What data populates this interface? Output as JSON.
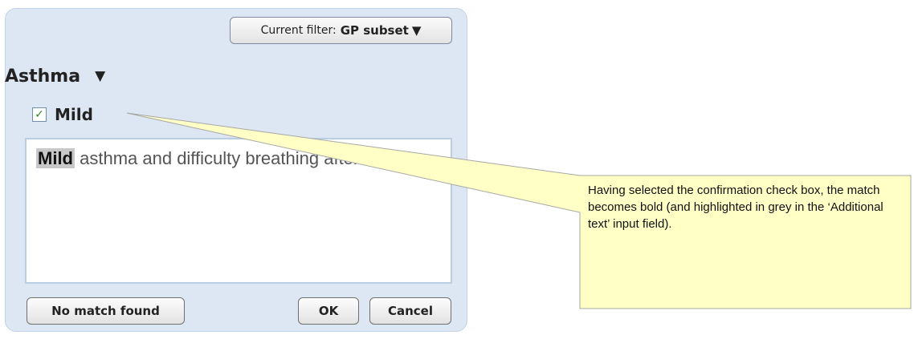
{
  "dialog": {
    "filter": {
      "prefix": "Current filter:",
      "value": "GP subset",
      "arrow": "▼"
    },
    "heading": {
      "text": "Asthma",
      "arrow": "▼"
    },
    "confirm_checkbox": {
      "label": "Mild",
      "checked": true,
      "check_glyph": "✓"
    },
    "additional_text": {
      "match": "Mild",
      "rest": " asthma and difficulty breathing after exercise"
    },
    "buttons": {
      "no_match": "No match found",
      "ok": "OK",
      "cancel": "Cancel"
    }
  },
  "callout": {
    "text": "Having selected the confirmation check box, the match becomes bold (and highlighted in grey in the ‘Additional text’ input field).",
    "fill_color": "#ffffc6",
    "border_color": "#a7a7a7"
  }
}
